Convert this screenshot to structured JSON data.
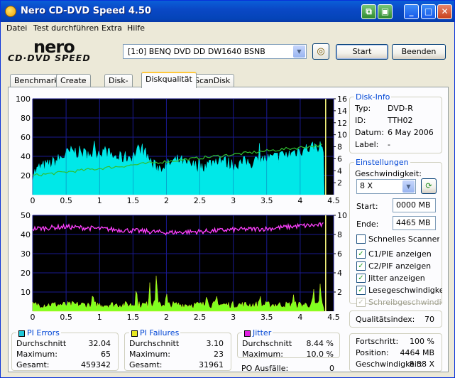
{
  "window": {
    "title": "Nero CD-DVD Speed 4.50"
  },
  "menu": [
    "Datei",
    "Test durchführen",
    "Extra",
    "Hilfe"
  ],
  "logo": {
    "line1": "nero",
    "line2": "CD·DVD SPEED"
  },
  "drive": {
    "selected": "[1:0]  BENQ DVD DD DW1640 BSNB"
  },
  "buttons": {
    "start": "Start",
    "end": "Beenden"
  },
  "tabs": [
    "Benchmark",
    "Create Disc",
    "Disk-Info",
    "Diskqualität",
    "ScanDisk"
  ],
  "active_tab": "Diskqualität",
  "disk_info": {
    "title": "Disk-Info",
    "rows": [
      {
        "label": "Typ:",
        "value": "DVD-R"
      },
      {
        "label": "ID:",
        "value": "TTH02"
      },
      {
        "label": "Datum:",
        "value": "6 May 2006"
      },
      {
        "label": "Label:",
        "value": "-"
      }
    ]
  },
  "settings": {
    "title": "Einstellungen",
    "speed_label": "Geschwindigkeit:",
    "speed_value": "8 X",
    "start_label": "Start:",
    "start_value": "0000 MB",
    "end_label": "Ende:",
    "end_value": "4465 MB",
    "checkboxes": [
      {
        "label": "Schnelles Scannen",
        "checked": false,
        "enabled": true
      },
      {
        "label": "C1/PIE anzeigen",
        "checked": true,
        "enabled": true
      },
      {
        "label": "C2/PIF anzeigen",
        "checked": true,
        "enabled": true
      },
      {
        "label": "Jitter anzeigen",
        "checked": true,
        "enabled": true
      },
      {
        "label": "Lesegeschwindigkeit a",
        "checked": true,
        "enabled": true
      },
      {
        "label": "Schreibgeschwindigkei",
        "checked": true,
        "enabled": false
      }
    ]
  },
  "quality": {
    "label": "Qualitätsindex:",
    "value": "70"
  },
  "progress": {
    "rows": [
      {
        "label": "Fortschritt:",
        "value": "100 %"
      },
      {
        "label": "Position:",
        "value": "4464 MB"
      },
      {
        "label": "Geschwindigkeit:",
        "value": "8.38 X"
      }
    ]
  },
  "pi_errors": {
    "title": "PI Errors",
    "color": "#20c8d8",
    "avg_label": "Durchschnitt",
    "avg": "32.04",
    "max_label": "Maximum:",
    "max": "65",
    "total_label": "Gesamt:",
    "total": "459342"
  },
  "pi_failures": {
    "title": "PI Failures",
    "color": "#e8e820",
    "avg_label": "Durchschnitt",
    "avg": "3.10",
    "max_label": "Maximum:",
    "max": "23",
    "total_label": "Gesamt:",
    "total": "31961"
  },
  "jitter": {
    "title": "Jitter",
    "color": "#e020e0",
    "avg_label": "Durchschnitt",
    "avg": "8.44 %",
    "max_label": "Maximum:",
    "max": "10.0 %",
    "po_label": "PO Ausfälle:",
    "po": "0"
  },
  "colors": {
    "plot_bg": "#000000",
    "grid": "#1a1a90",
    "pie": "#00e8e8",
    "pif": "#80ff20",
    "jitter": "#ff40ff",
    "speed": "#30c030",
    "cursor": "#ffff80"
  },
  "chart_data": [
    {
      "type": "area",
      "name": "PI Errors",
      "x_ticks": [
        0,
        0.5,
        1,
        1.5,
        2,
        2.5,
        3,
        3.5,
        4,
        4.5
      ],
      "xlim": [
        0,
        4.5
      ],
      "y_left_ticks": [
        20,
        40,
        60,
        80,
        100
      ],
      "ylim_left": [
        0,
        100
      ],
      "y_right_ticks": [
        2,
        4,
        6,
        8,
        10,
        12,
        14,
        16
      ],
      "ylim_right": [
        0,
        16
      ],
      "pie_profile": {
        "x": [
          0,
          0.05,
          0.1,
          0.2,
          0.3,
          0.4,
          0.5,
          0.6,
          0.7,
          0.8,
          0.9,
          1.0,
          1.1,
          1.2,
          1.3,
          1.4,
          1.5,
          1.6,
          1.7,
          1.8,
          1.9,
          2.0,
          2.1,
          2.2,
          2.3,
          2.4,
          2.5,
          2.6,
          2.7,
          2.8,
          2.9,
          3.0,
          3.1,
          3.2,
          3.3,
          3.4,
          3.5,
          3.6,
          3.7,
          3.8,
          3.9,
          4.0,
          4.1,
          4.2,
          4.3,
          4.36
        ],
        "y": [
          22,
          24,
          28,
          30,
          33,
          37,
          42,
          45,
          44,
          42,
          43,
          45,
          44,
          40,
          38,
          39,
          40,
          48,
          42,
          30,
          28,
          30,
          34,
          36,
          31,
          30,
          29,
          31,
          34,
          38,
          33,
          31,
          32,
          34,
          33,
          36,
          37,
          38,
          40,
          41,
          44,
          46,
          48,
          50,
          50,
          48
        ]
      },
      "read_speed": {
        "x": [
          0,
          4.36
        ],
        "y": [
          3.2,
          8.3
        ]
      }
    },
    {
      "type": "area",
      "name": "PI Failures / Jitter",
      "x_ticks": [
        0,
        0.5,
        1,
        1.5,
        2,
        2.5,
        3,
        3.5,
        4,
        4.5
      ],
      "xlim": [
        0,
        4.5
      ],
      "y_left_ticks": [
        10,
        20,
        30,
        40,
        50
      ],
      "ylim_left": [
        0,
        50
      ],
      "y_right_ticks": [
        2,
        4,
        6,
        8,
        10
      ],
      "ylim_right": [
        0,
        10
      ],
      "pif_base": 4,
      "pif_spikes": {
        "x": [
          0.9,
          1.55,
          1.75,
          1.85,
          2.0,
          2.6,
          2.75,
          3.4,
          3.9,
          4.2,
          4.3
        ],
        "y": [
          9,
          13,
          15,
          21,
          10,
          9,
          8,
          9,
          8,
          11,
          14
        ]
      },
      "jitter_profile": {
        "x": [
          0,
          0.5,
          1,
          1.5,
          2,
          2.5,
          3,
          3.5,
          4,
          4.36
        ],
        "y": [
          8.6,
          8.8,
          8.6,
          8.4,
          8.2,
          8.3,
          8.5,
          8.6,
          8.9,
          9.0
        ]
      }
    }
  ]
}
